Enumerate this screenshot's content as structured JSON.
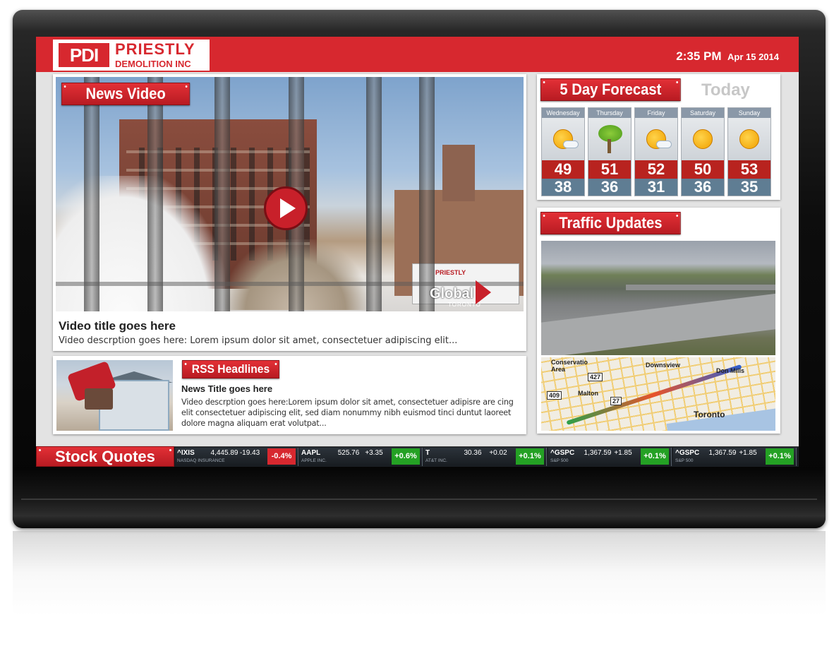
{
  "header": {
    "logo_mark": "PDI",
    "logo_line1": "PRIESTLY",
    "logo_line2": "DEMOLITION INC",
    "time": "2:35 PM",
    "date": "Apr 15 2014"
  },
  "news_video": {
    "tab_label": "News Video",
    "video_title": "Video title goes here",
    "video_description": "Video descrption goes here: Lorem ipsum dolor sit amet, consectetuer adipiscing elit...",
    "trailer_text": "PRIESTLY",
    "watermark": "Global",
    "watermark_sub": "TORONTO"
  },
  "rss": {
    "tab_label": "RSS Headlines",
    "news_title": "News Title goes here",
    "news_description": "Video descrption goes here:Lorem ipsum dolor sit amet, consectetuer adipisre are cing elit consectetuer adipiscing elit, sed diam nonummy nibh euismod tinci duntut laoreet dolore magna aliquam erat volutpat..."
  },
  "forecast": {
    "tab_label": "5 Day Forecast",
    "today_label": "Today",
    "days": [
      {
        "name": "Wednesday",
        "icon": "partly-cloudy-icon",
        "high": "49",
        "low": "38"
      },
      {
        "name": "Thursday",
        "icon": "windy-tree-icon",
        "high": "51",
        "low": "36"
      },
      {
        "name": "Friday",
        "icon": "partly-cloudy-icon",
        "high": "52",
        "low": "31"
      },
      {
        "name": "Saturday",
        "icon": "sunny-icon",
        "high": "50",
        "low": "36"
      },
      {
        "name": "Sunday",
        "icon": "sunny-icon",
        "high": "53",
        "low": "35"
      }
    ]
  },
  "traffic": {
    "tab_label": "Traffic Updates",
    "map_labels": [
      "Conservatio Area",
      "Downsview",
      "Don Mills",
      "Malton",
      "Toronto"
    ],
    "map_shields": [
      "427",
      "409",
      "27"
    ]
  },
  "stocks": {
    "tab_label": "Stock Quotes",
    "quotes": [
      {
        "symbol": "^IXIS",
        "price": "4,445.89",
        "change": "-19.43",
        "name": "NASDAQ INSURANCE",
        "pct": "-0.4%",
        "color": "#d7282f"
      },
      {
        "symbol": "AAPL",
        "price": "525.76",
        "change": "+3.35",
        "name": "APPLE INC.",
        "pct": "+0.6%",
        "color": "#24a124"
      },
      {
        "symbol": "T",
        "price": "30.36",
        "change": "+0.02",
        "name": "AT&T INC.",
        "pct": "+0.1%",
        "color": "#24a124"
      },
      {
        "symbol": "^GSPC",
        "price": "1,367.59",
        "change": "+1.85",
        "name": "S&P 500",
        "pct": "+0.1%",
        "color": "#24a124"
      },
      {
        "symbol": "^GSPC",
        "price": "1,367.59",
        "change": "+1.85",
        "name": "S&P 500",
        "pct": "+0.1%",
        "color": "#24a124"
      }
    ]
  },
  "colors": {
    "brand_red": "#d7282f",
    "high_temp": "#b8231f",
    "low_temp": "#5f7d93"
  }
}
